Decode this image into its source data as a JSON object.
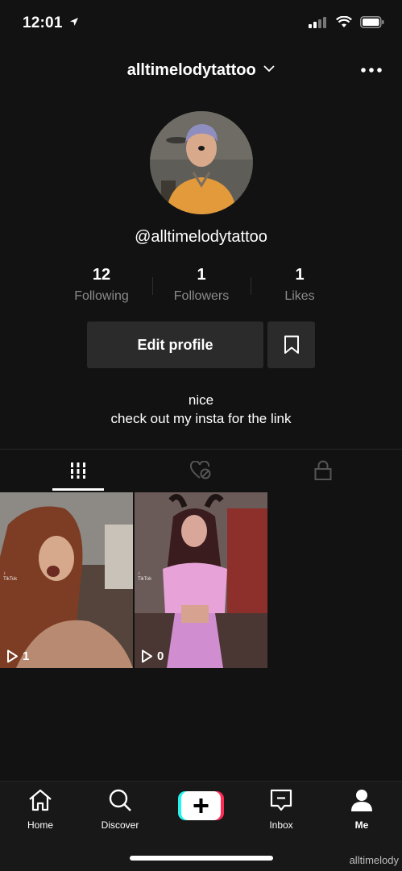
{
  "status_bar": {
    "time": "12:01"
  },
  "header": {
    "username": "alltimelodytattoo"
  },
  "profile": {
    "handle": "@alltimelodytattoo",
    "stats": [
      {
        "value": "12",
        "label": "Following"
      },
      {
        "value": "1",
        "label": "Followers"
      },
      {
        "value": "1",
        "label": "Likes"
      }
    ],
    "edit_label": "Edit profile",
    "bio_lines": [
      "nice",
      "check out my insta for the link"
    ]
  },
  "tabs": [
    {
      "icon": "grid-icon",
      "active": true
    },
    {
      "icon": "liked-hidden-icon",
      "active": false
    },
    {
      "icon": "lock-icon",
      "active": false
    }
  ],
  "videos": [
    {
      "views": "1",
      "watermark": "TikTok"
    },
    {
      "views": "0",
      "watermark": "TikTok"
    }
  ],
  "nav": {
    "home": "Home",
    "discover": "Discover",
    "inbox": "Inbox",
    "me": "Me"
  },
  "footer_watermark": "alltimelody",
  "colors": {
    "background": "#121212",
    "button": "#2b2b2b",
    "muted": "#8a8a8a",
    "accent_cyan": "#25f4ee",
    "accent_red": "#fe2c55"
  }
}
